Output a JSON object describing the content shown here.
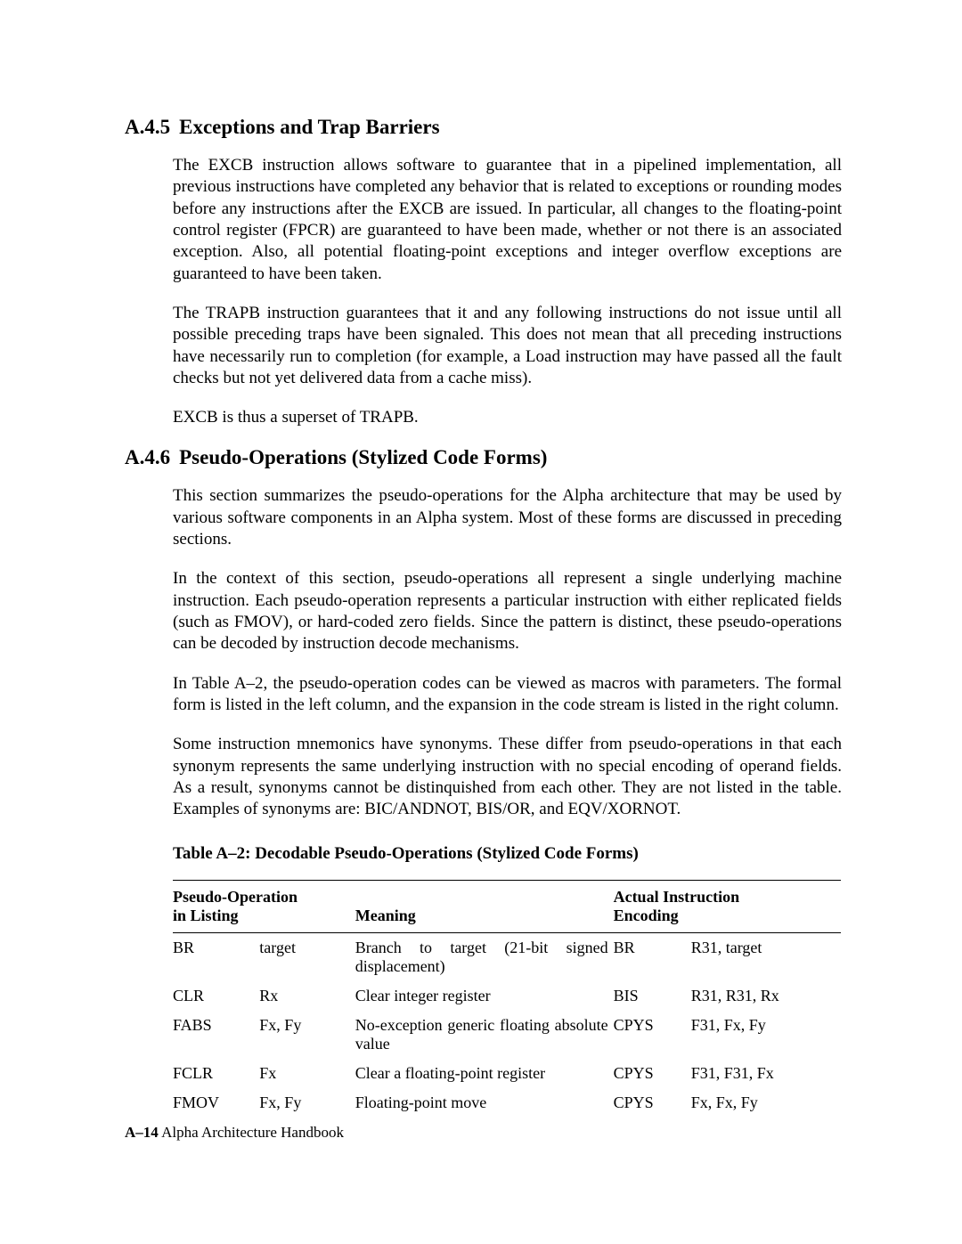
{
  "section1": {
    "number": "A.4.5",
    "title": "Exceptions and Trap Barriers",
    "p1": "The EXCB instruction allows software to guarantee that in a pipelined implementation, all previous instructions have completed any behavior that is related to exceptions or rounding modes before any instructions after the EXCB are issued. In particular, all changes to the floating-point control register (FPCR) are guaranteed to have been made, whether or not there is an associated exception. Also, all potential floating-point exceptions and integer overflow exceptions are guaranteed to have been taken.",
    "p2": "The TRAPB instruction guarantees that it and any following instructions do not issue until all possible preceding traps have been signaled. This does not mean that all preceding instructions have necessarily run to completion (for example, a Load instruction may have passed all the fault checks but not yet delivered data from a cache miss).",
    "p3": "EXCB is thus a superset of TRAPB."
  },
  "section2": {
    "number": "A.4.6",
    "title": "Pseudo-Operations (Stylized Code Forms)",
    "p1": "This section summarizes the pseudo-operations for the Alpha architecture that may be used by various software components in an Alpha system. Most of these forms are discussed in preceding sections.",
    "p2": "In the context of this section, pseudo-operations all represent a single underlying machine instruction.  Each pseudo-operation represents a particular instruction with either replicated fields (such as FMOV), or hard-coded zero fields.  Since the pattern is distinct, these pseudo-operations can be decoded by instruction decode mechanisms.",
    "p3": "In Table A–2, the pseudo-operation codes can be viewed as macros with parameters. The formal form is listed in the left column, and the expansion in the code stream is listed in the right column.",
    "p4": "Some instruction mnemonics have synonyms. These differ from pseudo-operations in that each synonym represents the same underlying instruction with no special encoding of operand fields. As a result, synonyms cannot be distinquished from each other. They are not listed in the table. Examples of synonyms are: BIC/ANDNOT, BIS/OR, and EQV/XORNOT."
  },
  "table": {
    "caption": "Table A–2:  Decodable Pseudo-Operations (Stylized Code Forms)",
    "head": {
      "col1a": "Pseudo-Operation",
      "col1b": "in Listing",
      "col2": "Meaning",
      "col3a": "Actual Instruction",
      "col3b": "Encoding"
    },
    "rows": [
      {
        "op": "BR",
        "arg": "target",
        "meaning": "Branch to target (21-bit signed displacement)",
        "inst": "BR",
        "enc": "R31, target"
      },
      {
        "op": "CLR",
        "arg": "Rx",
        "meaning": "Clear integer register",
        "inst": "BIS",
        "enc": "R31, R31, Rx"
      },
      {
        "op": "FABS",
        "arg": "Fx, Fy",
        "meaning": "No-exception generic floating absolute value",
        "inst": "CPYS",
        "enc": "F31, Fx, Fy"
      },
      {
        "op": "FCLR",
        "arg": "Fx",
        "meaning": "Clear a floating-point register",
        "inst": "CPYS",
        "enc": "F31, F31, Fx"
      },
      {
        "op": "FMOV",
        "arg": "Fx, Fy",
        "meaning": "Floating-point move",
        "inst": "CPYS",
        "enc": "Fx, Fx, Fy"
      }
    ]
  },
  "footer": {
    "page": "A–14",
    "book": "Alpha Architecture Handbook"
  }
}
